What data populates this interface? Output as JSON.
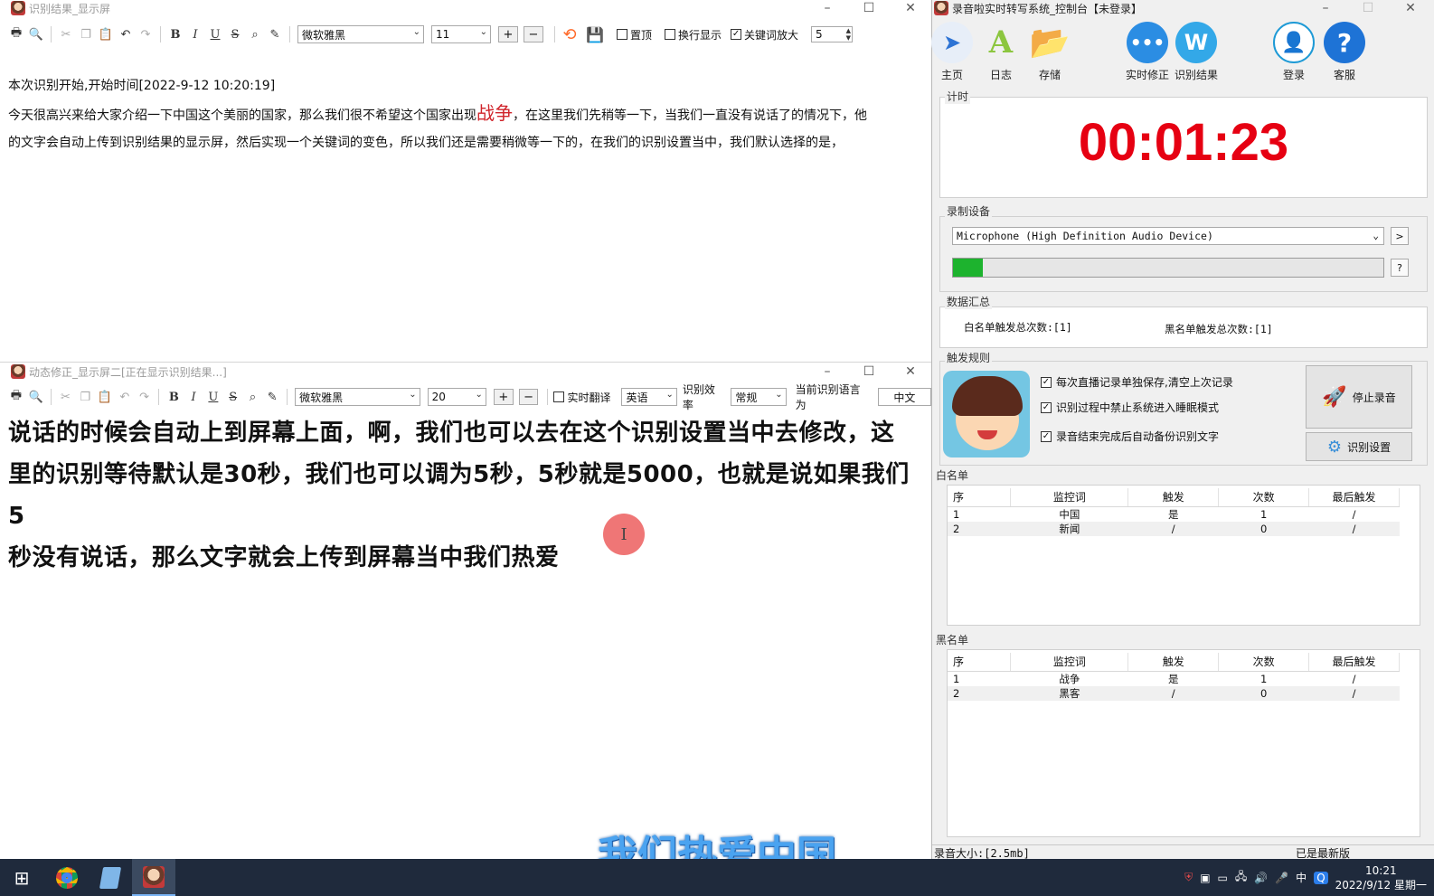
{
  "win1": {
    "title": "识别结果_显示屏",
    "font": "微软雅黑",
    "size": "11",
    "chk_top": "置顶",
    "chk_wrap": "换行显示",
    "chk_kw": "关键词放大",
    "kw_scale": "5",
    "line_start": "本次识别开始,开始时间[2022-9-12 10:20:19]",
    "p1_a": "今天很高兴来给大家介绍一下中国这个美丽的国家，那么我们很不希望这个国家出现",
    "p1_kw": "战争",
    "p1_b": "，在这里我们先稍等一下，当我们一直没有说话了的情况下，他",
    "p2": "的文字会自动上传到识别结果的显示屏，然后实现一个关键词的变色，所以我们还是需要稍微等一下的，在我们的识别设置当中，我们默认选择的是，"
  },
  "win2": {
    "title": "动态修正_显示屏二[正在显示识别结果...]",
    "font": "微软雅黑",
    "size": "20",
    "chk_translate": "实时翻译",
    "lang": "英语",
    "eff_label": "识别效率",
    "eff_value": "常规",
    "cur_lang_label": "当前识别语言为",
    "cur_lang": "中文",
    "text_1": "说话的时候会自动上到屏幕上面，啊，我们也可以去在这个识别设置当中去修改，这",
    "text_2": "里的识别等待默认是30秒，我们也可以调为5秒，5秒就是5000，也就是说如果我们5",
    "text_3": "秒没有说话，那么文字就会上传到屏幕当中我们热爱"
  },
  "console": {
    "title": "录音啦实时转写系统_控制台【未登录】",
    "btn_home": "主页",
    "btn_log": "日志",
    "btn_save": "存储",
    "btn_fix": "实时修正",
    "btn_result": "识别结果",
    "btn_login": "登录",
    "btn_service": "客服",
    "timer_label": "计时",
    "timer": "00:01:23",
    "device_label": "录制设备",
    "device": "Microphone (High Definition Audio Device)",
    "device_more": ">",
    "level_help": "?",
    "level_fraction": 0.07,
    "summary_label": "数据汇总",
    "white_total": "白名单触发总次数:[1]",
    "black_total": "黑名单触发总次数:[1]",
    "rules_label": "触发规则",
    "rule1": "每次直播记录单独保存,清空上次记录",
    "rule2": "识别过程中禁止系统进入睡眠模式",
    "rule3": "录音结束完成后自动备份识别文字",
    "stop_btn": "停止录音",
    "settings_btn": "识别设置",
    "white_label": "白名单",
    "black_label": "黑名单",
    "columns": [
      "序",
      "监控词",
      "触发",
      "次数",
      "最后触发"
    ],
    "white_rows": [
      [
        "1",
        "中国",
        "是",
        "1",
        "/"
      ],
      [
        "2",
        "新闻",
        "/",
        "0",
        "/"
      ]
    ],
    "black_rows": [
      [
        "1",
        "战争",
        "是",
        "1",
        "/"
      ],
      [
        "2",
        "黑客",
        "/",
        "0",
        "/"
      ]
    ],
    "status_size": "录音大小:[2.5mb]",
    "status_ver": "已是最新版"
  },
  "subtitle": "我们热爱中国",
  "taskbar": {
    "ime": "中",
    "time": "10:21",
    "date": "2022/9/12 星期一"
  },
  "colors": {
    "timer": "#e60012",
    "keyword": "#d0242b",
    "level": "#1db32e",
    "subtitle": "#4aa3f0"
  }
}
